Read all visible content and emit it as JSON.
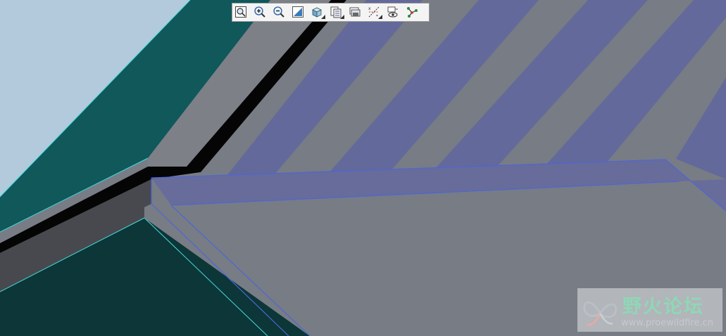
{
  "viewport": {
    "background_color": "#7a7e84",
    "colors": {
      "sky": "#b2cadc",
      "teal_surface": "#10585a",
      "dark_teal_surface": "#0c3637",
      "gray_surface": "#787c84",
      "dark_gray_surface": "#48494e",
      "black_gap": "#050505",
      "blue_stripe": "#63699a",
      "edge_highlight": "#45d9dd",
      "selection_edge": "#4d66d6"
    }
  },
  "toolbar": {
    "buttons": [
      {
        "name": "refit-button",
        "icon": "refit-icon"
      },
      {
        "name": "zoom-in-button",
        "icon": "zoom-in-icon"
      },
      {
        "name": "zoom-out-button",
        "icon": "zoom-out-icon"
      },
      {
        "name": "repaint-button",
        "icon": "repaint-icon"
      },
      {
        "name": "display-style-button",
        "icon": "shaded-cube-icon"
      },
      {
        "name": "saved-views-button",
        "icon": "saved-views-icon"
      },
      {
        "name": "layers-button",
        "icon": "layers-icon"
      },
      {
        "name": "datum-display-button",
        "icon": "datum-axes-icon"
      },
      {
        "name": "annotation-display-button",
        "icon": "eye-display-icon"
      },
      {
        "name": "spin-center-button",
        "icon": "spin-center-icon"
      }
    ]
  },
  "watermark": {
    "brand": "野火论坛",
    "url": "www.proewildfire.cn"
  }
}
